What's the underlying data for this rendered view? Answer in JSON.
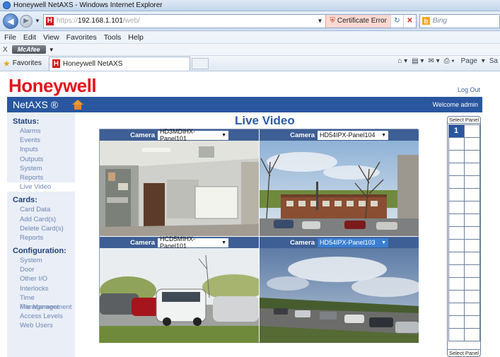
{
  "window": {
    "title": "Honeywell NetAXS - Windows Internet Explorer"
  },
  "address": {
    "url_scheme": "https://",
    "url_host": "192.168.1.101",
    "url_path": "/web/",
    "cert_error": "Certificate Error",
    "search_placeholder": "Bing"
  },
  "menu": {
    "items": [
      "File",
      "Edit",
      "View",
      "Favorites",
      "Tools",
      "Help"
    ]
  },
  "toolbar": {
    "mcafee": "McAfee"
  },
  "favorites": {
    "label": "Favorites",
    "tab_title": "Honeywell NetAXS",
    "page_menu": "Page",
    "safety_menu": "Sa"
  },
  "header": {
    "brand": "Honeywell",
    "logout": "Log Out",
    "app_name": "NetAXS ®",
    "welcome": "Welcome admin"
  },
  "sidebar": {
    "status": {
      "heading": "Status:",
      "items": [
        "Alarms",
        "Events",
        "Inputs",
        "Outputs",
        "System",
        "Reports",
        "Live Video"
      ]
    },
    "cards": {
      "heading": "Cards:",
      "items": [
        "Card Data",
        "Add Card(s)",
        "Delete Card(s)",
        "Reports"
      ]
    },
    "config": {
      "heading": "Configuration:",
      "items": [
        "System",
        "Door",
        "Other I/O",
        "Interlocks",
        "Time Management",
        "File Management",
        "Access Levels",
        "Web Users"
      ]
    },
    "active": "Live Video"
  },
  "main": {
    "title": "Live Video",
    "cameras": [
      {
        "label": "Camera",
        "selected": "HD3MDIHX-Panel101"
      },
      {
        "label": "Camera",
        "selected": "HD54IPX-Panel104"
      },
      {
        "label": "Camera",
        "selected": "HCD5MIHX-Panel101"
      },
      {
        "label": "Camera",
        "selected": "HD54IPX-Panel103"
      }
    ]
  },
  "panel_selector": {
    "header": "Select Panel",
    "footer": "Select Panel",
    "selected": "1"
  }
}
